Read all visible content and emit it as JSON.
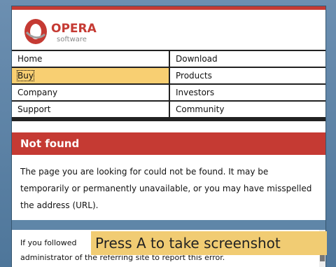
{
  "logo": {
    "brand": "OPERA",
    "sub": "software"
  },
  "nav": [
    [
      "Home",
      "Download"
    ],
    [
      "Buy",
      "Products"
    ],
    [
      "Company",
      "Investors"
    ],
    [
      "Support",
      "Community"
    ]
  ],
  "page": {
    "title": "Not found",
    "message": "The page you are looking for could not be found. It may be temporarily or permanently unavailable, or you may have misspelled the address (URL).",
    "followed": "If you followed",
    "admin": "administrator of the referring site to report this error."
  },
  "overlay": {
    "hint": "Press A to take screenshot"
  }
}
